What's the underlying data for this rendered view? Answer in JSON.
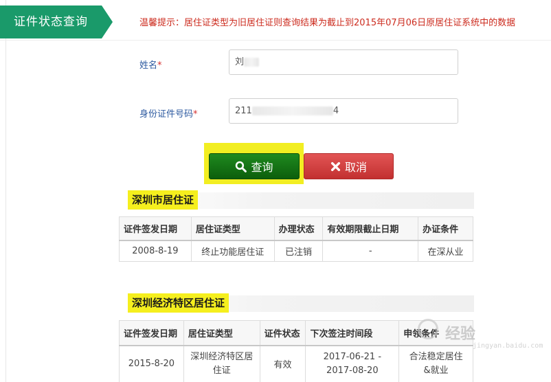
{
  "header": {
    "tab_title": "证件状态查询",
    "notice": "温馨提示：居住证类型为旧居住证则查询结果为截止到2015年07月06日原居住证系统中的数据"
  },
  "form": {
    "name_label": "姓名",
    "name_value": "刘",
    "id_label": "身份证件号码",
    "id_prefix": "211",
    "id_suffix": "4",
    "required_mark": "*"
  },
  "buttons": {
    "query": "查询",
    "cancel": "取消"
  },
  "section1": {
    "title": "深圳市居住证",
    "headers": [
      "证件签发日期",
      "居住证类型",
      "办理状态",
      "有效期限截止日期",
      "办证条件"
    ],
    "row": [
      "2008-8-19",
      "终止功能居住证",
      "已注销",
      "-",
      "在深从业"
    ]
  },
  "section2": {
    "title": "深圳经济特区居住证",
    "headers": [
      "证件签发日期",
      "居住证类型",
      "证件状态",
      "下次签注时间段",
      "申领条件"
    ],
    "row_c1": "2015-8-20",
    "row_c2a": "深圳经济特区居",
    "row_c2b": "住证",
    "row_c3": "有效",
    "row_c4a": "2017-06-21 -",
    "row_c4b": "2017-08-20",
    "row_c5a": "合法稳定居住",
    "row_c5b": "&就业"
  },
  "watermark": {
    "text": "经验",
    "sub": "jingyan.baidu.com"
  },
  "colors": {
    "tab": "#1a9a6a",
    "notice": "#cc2b1e",
    "query_button": "#0c5e0c",
    "cancel_button": "#c23030",
    "highlight": "#f2ee22"
  }
}
